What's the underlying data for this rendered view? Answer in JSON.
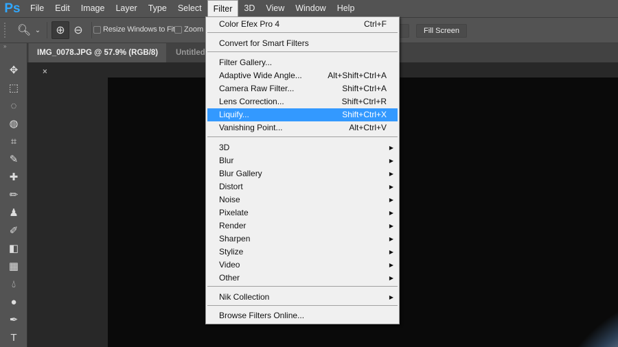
{
  "app": {
    "logo": "Ps"
  },
  "menubar": [
    "File",
    "Edit",
    "Image",
    "Layer",
    "Type",
    "Select",
    "Filter",
    "3D",
    "View",
    "Window",
    "Help"
  ],
  "options": {
    "resize_windows": "Resize Windows to Fit",
    "zoom_all": "Zoom",
    "fill_screen": "Fill Screen"
  },
  "tabs": [
    {
      "label": "IMG_0078.JPG @ 57.9% (RGB/8)",
      "close": "×"
    },
    {
      "label": "Untitled"
    }
  ],
  "filter_menu": {
    "groups": [
      [
        {
          "label": "Color Efex Pro 4",
          "shortcut": "Ctrl+F"
        }
      ],
      [
        {
          "label": "Convert for Smart Filters"
        }
      ],
      [
        {
          "label": "Filter Gallery..."
        },
        {
          "label": "Adaptive Wide Angle...",
          "shortcut": "Alt+Shift+Ctrl+A"
        },
        {
          "label": "Camera Raw Filter...",
          "shortcut": "Shift+Ctrl+A"
        },
        {
          "label": "Lens Correction...",
          "shortcut": "Shift+Ctrl+R"
        },
        {
          "label": "Liquify...",
          "shortcut": "Shift+Ctrl+X",
          "highlighted": true
        },
        {
          "label": "Vanishing Point...",
          "shortcut": "Alt+Ctrl+V"
        }
      ],
      [
        {
          "label": "3D",
          "submenu": true
        },
        {
          "label": "Blur",
          "submenu": true
        },
        {
          "label": "Blur Gallery",
          "submenu": true
        },
        {
          "label": "Distort",
          "submenu": true
        },
        {
          "label": "Noise",
          "submenu": true
        },
        {
          "label": "Pixelate",
          "submenu": true
        },
        {
          "label": "Render",
          "submenu": true
        },
        {
          "label": "Sharpen",
          "submenu": true
        },
        {
          "label": "Stylize",
          "submenu": true
        },
        {
          "label": "Video",
          "submenu": true
        },
        {
          "label": "Other",
          "submenu": true
        }
      ],
      [
        {
          "label": "Nik Collection",
          "submenu": true
        }
      ],
      [
        {
          "label": "Browse Filters Online..."
        }
      ]
    ]
  },
  "tools": [
    "move-icon",
    "marquee-icon",
    "lasso-icon",
    "quick-select-icon",
    "crop-icon",
    "eyedropper-icon",
    "healing-icon",
    "brush-icon",
    "stamp-icon",
    "history-brush-icon",
    "eraser-icon",
    "gradient-icon",
    "blur-icon",
    "dodge-icon",
    "pen-icon",
    "type-icon"
  ],
  "colors": {
    "highlight": "#3399ff",
    "ps_blue": "#31a8ff"
  }
}
